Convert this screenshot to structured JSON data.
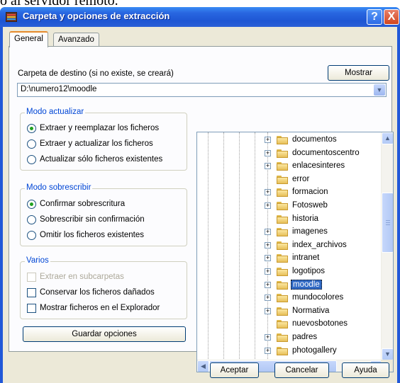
{
  "top_fragment": "o al servidor remoto.",
  "window": {
    "title": "Carpeta y opciones de extracción",
    "help_glyph": "?",
    "close_glyph": "X"
  },
  "tabs": [
    {
      "label": "General",
      "active": true
    },
    {
      "label": "Avanzado",
      "active": false
    }
  ],
  "destination": {
    "label": "Carpeta de destino (si no existe, se creará)",
    "show_button": "Mostrar",
    "value": "D:\\numero12\\moodle"
  },
  "update_mode": {
    "title": "Modo actualizar",
    "options": [
      {
        "label": "Extraer y reemplazar los ficheros",
        "selected": true
      },
      {
        "label": "Extraer y actualizar los ficheros",
        "selected": false
      },
      {
        "label": "Actualizar sólo ficheros existentes",
        "selected": false
      }
    ]
  },
  "overwrite_mode": {
    "title": "Modo sobrescribir",
    "options": [
      {
        "label": "Confirmar sobrescritura",
        "selected": true
      },
      {
        "label": "Sobrescribir sin confirmación",
        "selected": false
      },
      {
        "label": "Omitir los ficheros existentes",
        "selected": false
      }
    ]
  },
  "misc": {
    "title": "Varios",
    "options": [
      {
        "label": "Extraer en subcarpetas",
        "checked": false,
        "disabled": true
      },
      {
        "label": "Conservar los ficheros dañados",
        "checked": false,
        "disabled": false
      },
      {
        "label": "Mostrar ficheros en el Explorador",
        "checked": false,
        "disabled": false
      }
    ]
  },
  "save_options_button": "Guardar opciones",
  "folder_tree": [
    {
      "name": "documentos",
      "expandable": true,
      "selected": false
    },
    {
      "name": "documentoscentro",
      "expandable": true,
      "selected": false
    },
    {
      "name": "enlacesinteres",
      "expandable": true,
      "selected": false
    },
    {
      "name": "error",
      "expandable": false,
      "selected": false
    },
    {
      "name": "formacion",
      "expandable": true,
      "selected": false
    },
    {
      "name": "Fotosweb",
      "expandable": true,
      "selected": false
    },
    {
      "name": "historia",
      "expandable": false,
      "selected": false
    },
    {
      "name": "imagenes",
      "expandable": true,
      "selected": false
    },
    {
      "name": "index_archivos",
      "expandable": true,
      "selected": false
    },
    {
      "name": "intranet",
      "expandable": true,
      "selected": false
    },
    {
      "name": "logotipos",
      "expandable": true,
      "selected": false
    },
    {
      "name": "moodle",
      "expandable": true,
      "selected": true
    },
    {
      "name": "mundocolores",
      "expandable": true,
      "selected": false
    },
    {
      "name": "Normativa",
      "expandable": true,
      "selected": false
    },
    {
      "name": "nuevosbotones",
      "expandable": false,
      "selected": false
    },
    {
      "name": "padres",
      "expandable": true,
      "selected": false
    },
    {
      "name": "photogallery",
      "expandable": true,
      "selected": false
    }
  ],
  "scroll_arrows": {
    "up": "▲",
    "down": "▼",
    "left": "◀",
    "right": "▶",
    "combo": "▼"
  },
  "footer": {
    "accept": "Aceptar",
    "cancel": "Cancelar",
    "help": "Ayuda"
  },
  "colors": {
    "titlebar": "#2158d8",
    "group_title": "#0046d5",
    "selection": "#316ac5",
    "radio_dot": "#21a121"
  }
}
